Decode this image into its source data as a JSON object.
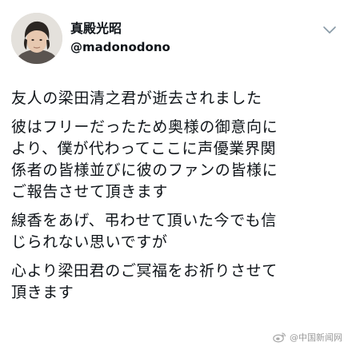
{
  "tweet": {
    "author": {
      "display_name": "真殿光昭",
      "handle": "@madonodono"
    },
    "more_icon": "chevron-down-icon",
    "paragraphs": [
      "友人の梁田清之君が逝去されました",
      "彼はフリーだったため奥様の御意向に\nより、僕が代わってここに声優業界関\n係者の皆様並びに彼のファンの皆様に\nご報告させて頂きます",
      "線香をあげ、弔わせて頂いた今でも信\nじられない思いですが",
      "心より梁田君のご冥福をお祈りさせて\n頂きます"
    ]
  },
  "watermark": {
    "icon": "weibo-icon",
    "text": "@中国新闻网"
  }
}
